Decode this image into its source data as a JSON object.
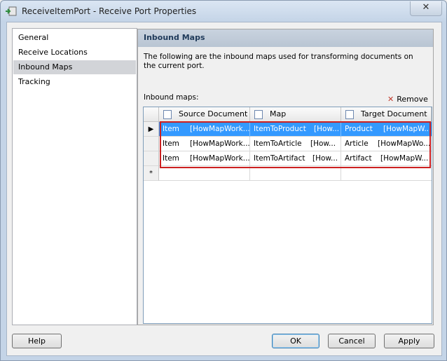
{
  "window": {
    "title": "ReceiveItemPort - Receive Port Properties",
    "close_glyph": "✕"
  },
  "nav": {
    "items": [
      {
        "label": "General"
      },
      {
        "label": "Receive Locations"
      },
      {
        "label": "Inbound Maps",
        "selected": true
      },
      {
        "label": "Tracking"
      }
    ]
  },
  "panel": {
    "title": "Inbound Maps",
    "description": "The following are the inbound maps used for transforming documents on the current port.",
    "maps_label": "Inbound maps:",
    "remove_label": "Remove",
    "remove_glyph": "✕"
  },
  "grid": {
    "columns": [
      {
        "label": "Source Document",
        "icon": "schema-icon"
      },
      {
        "label": "Map",
        "icon": "map-icon"
      },
      {
        "label": "Target Document",
        "icon": "schema-icon"
      }
    ],
    "rows": [
      {
        "marker": "▶",
        "source": "Item",
        "source_asm": "[HowMapWork...",
        "map": "ItemToProduct",
        "map_asm": "[How...",
        "target": "Product",
        "target_asm": "[HowMapW..."
      },
      {
        "marker": "",
        "source": "Item",
        "source_asm": "[HowMapWork...",
        "map": "ItemToArticle",
        "map_asm": "[How...",
        "target": "Article",
        "target_asm": "[HowMapWo..."
      },
      {
        "marker": "",
        "source": "Item",
        "source_asm": "[HowMapWork...",
        "map": "ItemToArtifact",
        "map_asm": "[How...",
        "target": "Artifact",
        "target_asm": "[HowMapW..."
      }
    ],
    "new_row_marker": "*"
  },
  "buttons": {
    "help": "Help",
    "ok": "OK",
    "cancel": "Cancel",
    "apply": "Apply"
  },
  "colors": {
    "selection": "#3399ff",
    "highlight_border": "#cc2020",
    "panel_header": "#c9d3df"
  }
}
